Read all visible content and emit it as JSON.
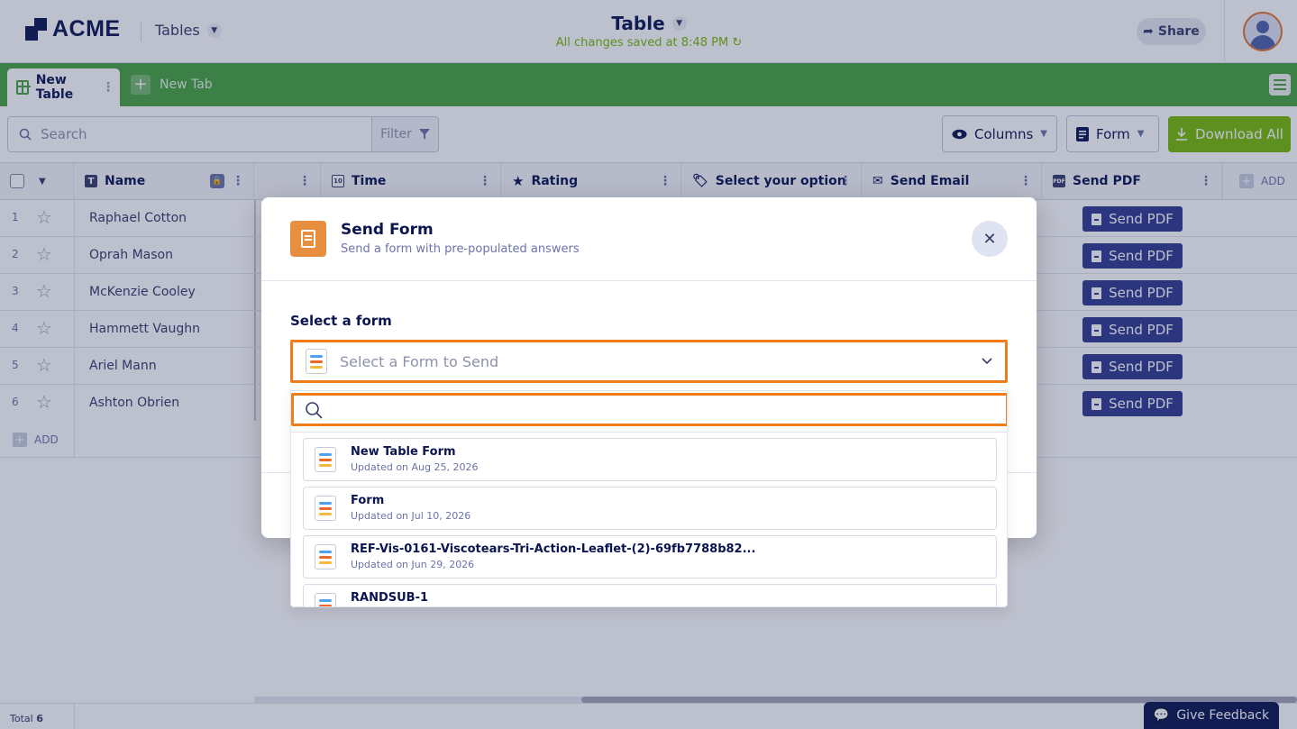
{
  "header": {
    "logo_text": "ACME",
    "tables_label": "Tables",
    "doc_title": "Table",
    "saved_status": "All changes saved at 8:48 PM",
    "share_label": "Share"
  },
  "tabs": {
    "active_label": "New Table",
    "new_tab_label": "New Tab"
  },
  "toolbar": {
    "search_placeholder": "Search",
    "filter_label": "Filter",
    "columns_label": "Columns",
    "form_label": "Form",
    "download_label": "Download All"
  },
  "table": {
    "columns": [
      "Name",
      "Time",
      "Rating",
      "Select your option",
      "Send Email",
      "Send PDF"
    ],
    "add_column_label": "ADD",
    "rows": [
      {
        "num": "1",
        "name": "Raphael Cotton",
        "action": "Send PDF"
      },
      {
        "num": "2",
        "name": "Oprah Mason",
        "action": "Send PDF"
      },
      {
        "num": "3",
        "name": "McKenzie Cooley",
        "action": "Send PDF"
      },
      {
        "num": "4",
        "name": "Hammett Vaughn",
        "action": "Send PDF"
      },
      {
        "num": "5",
        "name": "Ariel Mann",
        "action": "Send PDF"
      },
      {
        "num": "6",
        "name": "Ashton Obrien",
        "action": "Send PDF"
      }
    ],
    "add_row_label": "ADD",
    "total_label": "Total",
    "total_count": "6"
  },
  "feedback_label": "Give Feedback",
  "modal": {
    "title": "Send Form",
    "subtitle": "Send a form with pre-populated answers",
    "field_label": "Select a form",
    "select_placeholder": "Select a Form to Send",
    "search_value": "",
    "options": [
      {
        "title": "New Table Form",
        "date": "Updated on Aug 25, 2026"
      },
      {
        "title": "Form",
        "date": "Updated on Jul 10, 2026"
      },
      {
        "title": "REF-Vis-0161-Viscotears-Tri-Action-Leaflet-(2)-69fb7788b82...",
        "date": "Updated on Jun 29, 2026"
      },
      {
        "title": "RANDSUB-1",
        "date": ""
      }
    ]
  },
  "colors": {
    "brand_green": "#48a43f",
    "download_green": "#78bb07",
    "send_pdf_navy": "#2f3a8f",
    "focus_orange": "#f07d1a",
    "modal_icon_orange": "#e78f3f"
  }
}
